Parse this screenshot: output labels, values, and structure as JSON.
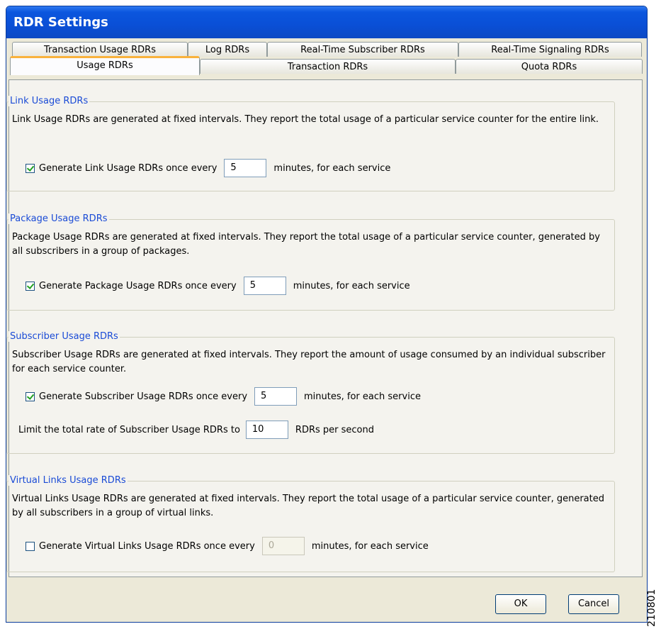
{
  "window": {
    "title": "RDR Settings"
  },
  "tabs": {
    "row1": [
      "Transaction Usage RDRs",
      "Log RDRs",
      "Real-Time Subscriber RDRs",
      "Real-Time Signaling RDRs"
    ],
    "row2": [
      "Usage RDRs",
      "Transaction RDRs",
      "Quota RDRs"
    ],
    "active": "Usage RDRs"
  },
  "link": {
    "legend": "Link Usage RDRs",
    "desc": "Link Usage RDRs are generated at fixed intervals. They report the total usage of a particular service counter for the entire link.",
    "checkbox_label": "Generate Link Usage RDRs once every",
    "checked": true,
    "value": "5",
    "suffix": "minutes, for each service"
  },
  "package": {
    "legend": "Package Usage RDRs",
    "desc": "Package Usage RDRs are generated at fixed intervals. They report the total usage of a particular service counter, generated by all subscribers in a group of packages.",
    "checkbox_label": "Generate Package Usage RDRs once every",
    "checked": true,
    "value": "5",
    "suffix": "minutes, for each service"
  },
  "subscriber": {
    "legend": "Subscriber Usage RDRs",
    "desc": "Subscriber Usage RDRs are generated at fixed intervals. They report the amount of usage consumed by an individual subscriber for each service counter.",
    "checkbox_label": "Generate Subscriber Usage RDRs once every",
    "checked": true,
    "value": "5",
    "suffix": "minutes, for each service",
    "limit_label": "Limit the total rate of Subscriber Usage RDRs to",
    "limit_value": "10",
    "limit_suffix": "RDRs per second"
  },
  "virtual": {
    "legend": "Virtual Links Usage RDRs",
    "desc": "Virtual Links Usage RDRs are generated at fixed intervals. They report the total usage of a particular service counter, generated by all subscribers in a group of virtual links.",
    "checkbox_label": "Generate Virtual Links Usage RDRs once every",
    "checked": false,
    "value": "0",
    "suffix": "minutes, for each service"
  },
  "buttons": {
    "ok": "OK",
    "cancel": "Cancel"
  },
  "figure_number": "210801"
}
